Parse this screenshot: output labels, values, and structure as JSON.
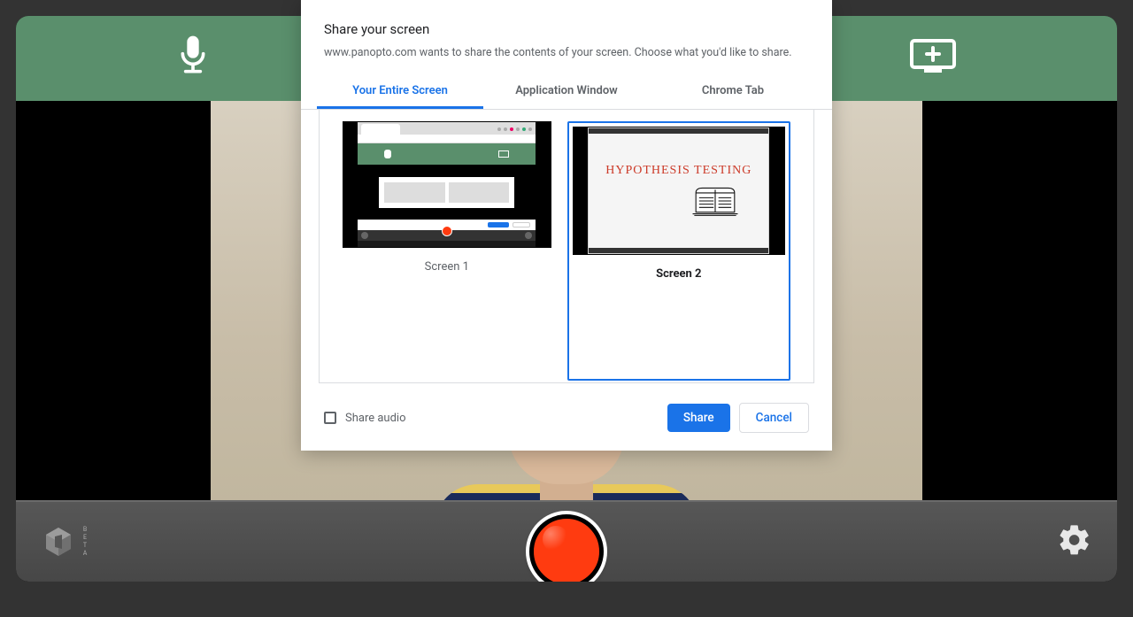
{
  "topbar": {
    "mic_icon": "microphone-icon",
    "screen_add_icon": "add-screen-icon"
  },
  "bottombar": {
    "beta_label": "BETA",
    "settings_icon": "gear-icon"
  },
  "dialog": {
    "title": "Share your screen",
    "description": "www.panopto.com wants to share the contents of your screen. Choose what you'd like to share.",
    "tabs": {
      "entire": "Your Entire Screen",
      "window": "Application Window",
      "chrome_tab": "Chrome Tab"
    },
    "active_tab": "entire",
    "screens": [
      {
        "label": "Screen 1",
        "selected": false
      },
      {
        "label": "Screen 2",
        "selected": true
      }
    ],
    "slide_text": "HYPOTHESIS TESTING",
    "share_audio_label": "Share audio",
    "share_button": "Share",
    "cancel_button": "Cancel"
  }
}
